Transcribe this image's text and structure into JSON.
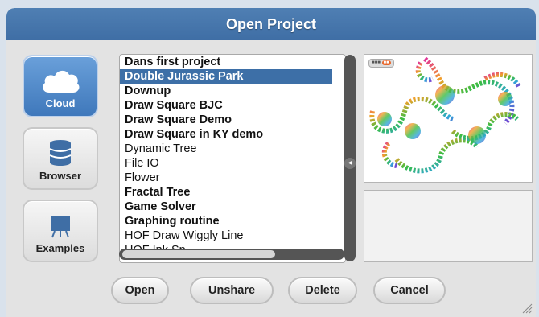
{
  "dialog": {
    "title": "Open Project"
  },
  "sources": [
    {
      "label": "Cloud",
      "icon": "cloud-icon",
      "active": true
    },
    {
      "label": "Browser",
      "icon": "database-icon",
      "active": false
    },
    {
      "label": "Examples",
      "icon": "examples-icon",
      "active": false
    }
  ],
  "projects": [
    {
      "label": "Dans first project",
      "bold": true,
      "selected": false
    },
    {
      "label": "Double Jurassic Park",
      "bold": true,
      "selected": true
    },
    {
      "label": "Downup",
      "bold": true,
      "selected": false
    },
    {
      "label": "Draw Square BJC",
      "bold": true,
      "selected": false
    },
    {
      "label": "Draw Square Demo",
      "bold": true,
      "selected": false
    },
    {
      "label": "Draw Square in KY demo",
      "bold": true,
      "selected": false
    },
    {
      "label": "Dynamic Tree",
      "bold": false,
      "selected": false
    },
    {
      "label": "File IO",
      "bold": false,
      "selected": false
    },
    {
      "label": "Flower",
      "bold": false,
      "selected": false
    },
    {
      "label": "Fractal Tree",
      "bold": true,
      "selected": false
    },
    {
      "label": "Game Solver",
      "bold": true,
      "selected": false
    },
    {
      "label": "Graphing routine",
      "bold": true,
      "selected": false
    },
    {
      "label": "HOF Draw Wiggly Line",
      "bold": false,
      "selected": false
    },
    {
      "label": "HOF Ink Sp...",
      "bold": false,
      "selected": false
    }
  ],
  "buttons": {
    "open": "Open",
    "unshare": "Unshare",
    "delete": "Delete",
    "cancel": "Cancel"
  },
  "colors": {
    "titlebar": "#3f6ea5",
    "selection": "#3d6fa7",
    "active_source": "#4a85c6"
  }
}
